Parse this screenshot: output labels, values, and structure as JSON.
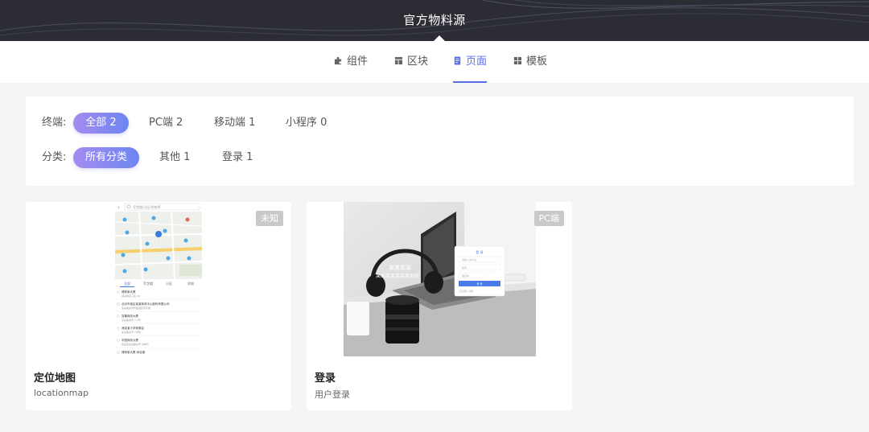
{
  "header": {
    "title": "官方物料源"
  },
  "tabs": [
    {
      "label": "组件",
      "icon": "puzzle-icon"
    },
    {
      "label": "区块",
      "icon": "block-icon"
    },
    {
      "label": "页面",
      "icon": "page-icon",
      "active": true
    },
    {
      "label": "模板",
      "icon": "template-icon"
    }
  ],
  "filters": {
    "terminal": {
      "label": "终端:",
      "options": [
        {
          "label": "全部 2",
          "selected": true
        },
        {
          "label": "PC端 2"
        },
        {
          "label": "移动端 1"
        },
        {
          "label": "小程序 0"
        }
      ]
    },
    "category": {
      "label": "分类:",
      "options": [
        {
          "label": "所有分类",
          "selected": true
        },
        {
          "label": "其他 1"
        },
        {
          "label": "登录 1"
        }
      ]
    }
  },
  "cards": [
    {
      "title": "定位地图",
      "subtitle": "locationmap",
      "badge": "未知",
      "preview": {
        "search_placeholder": "写字楼/小区/学校等",
        "tabs": [
          "全部",
          "写字楼",
          "小区",
          "学校"
        ],
        "list": [
          {
            "name": "博林家大厦",
            "addr": "某某街道三段 26"
          },
          {
            "name": "北京市某区某某商务中心股份有限公司",
            "addr": "某某路某号科技园区写字楼"
          },
          {
            "name": "凯撒商务大厦",
            "addr": "某某路某号 1-3号"
          },
          {
            "name": "海淀某小学家委会",
            "addr": "某某路某号 1号院"
          },
          {
            "name": "中国商务大厦",
            "addr": "某某区某某路某号 某单元"
          },
          {
            "name": "博林家大厦-综合楼",
            "addr": ""
          }
        ]
      }
    },
    {
      "title": "登录",
      "subtitle": "用户登录",
      "badge": "PC端",
      "preview": {
        "overlay_title": "某某某某",
        "overlay_sub": "某某某某某某某系统",
        "form_title": "登 录",
        "user_placeholder": "请输入用户名",
        "pass_placeholder": "密码",
        "code_placeholder": "验证码",
        "submit": "登 录",
        "links": "忘记密码 / 注册"
      }
    }
  ],
  "colors": {
    "accent": "#5b6ee8",
    "header_bg": "#2b2c34",
    "badge_bg": "#c9c9c9"
  }
}
